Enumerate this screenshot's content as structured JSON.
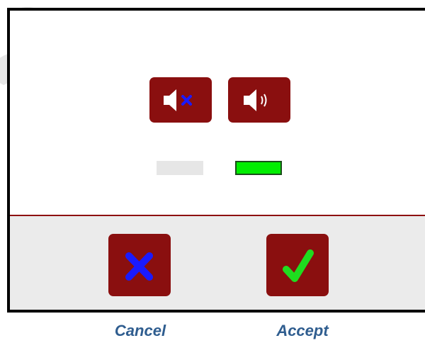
{
  "sound_options": [
    {
      "name": "mute",
      "icon": "speaker-muted-icon",
      "selected": false
    },
    {
      "name": "sound-on",
      "icon": "speaker-on-icon",
      "selected": true
    }
  ],
  "actions": {
    "cancel_label": "Cancel",
    "accept_label": "Accept"
  },
  "colors": {
    "button_bg": "#8a0f0f",
    "accent_blue": "#1a1aff",
    "accept_green": "#1fdd1f",
    "indicator_off": "#e6e6e6",
    "indicator_on": "#00ee00",
    "label_blue": "#2f5d8f",
    "divider": "#8e1010",
    "footer_bg": "#ebebeb"
  }
}
